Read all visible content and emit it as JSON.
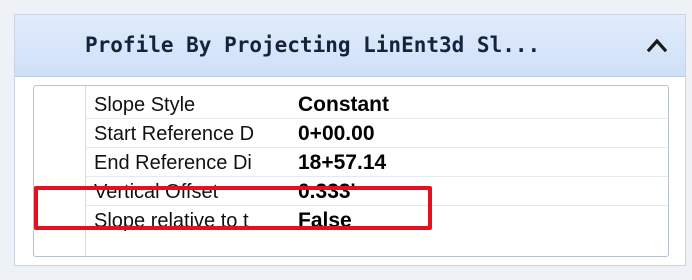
{
  "panel": {
    "title": "Profile By Projecting LinEnt3d Sl...",
    "collapse_icon": "chevron-up-icon"
  },
  "properties": [
    {
      "label": "Slope Style",
      "value": "Constant"
    },
    {
      "label": "Start Reference D",
      "value": "0+00.00"
    },
    {
      "label": "End Reference Di",
      "value": "18+57.14"
    },
    {
      "label": "Vertical Offset",
      "value": "0.333'"
    },
    {
      "label": "Slope relative to t",
      "value": "False"
    }
  ],
  "colors": {
    "header_bg": "#cfe0f7",
    "highlight": "#e3101f"
  }
}
